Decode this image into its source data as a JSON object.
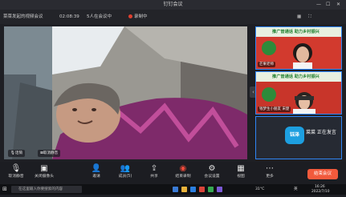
{
  "window": {
    "title": "钉钉会议"
  },
  "info": {
    "meeting_name": "菜菜发起的视频会议",
    "duration": "02:08:39",
    "participants": "5人在会议中",
    "recording": "录制中"
  },
  "main_video": {
    "mic_label": "话筒",
    "unmute_label": "取消静音"
  },
  "tiles": [
    {
      "name": "芒果老师",
      "banner": "推广普通话 助力乡村振兴"
    },
    {
      "name": "钱梦生小朋友",
      "sub": "宋楚",
      "banner": "推广普通话 助力乡村振兴"
    },
    {
      "name": "菜菜 正在发言",
      "logo_text": "钰泽"
    }
  ],
  "toolbar": {
    "items": [
      {
        "label": "取消静音",
        "icon": "mic-icon"
      },
      {
        "label": "关闭摄像头",
        "icon": "camera-icon"
      },
      {
        "label": "邀请",
        "icon": "invite-icon"
      },
      {
        "label": "成员(5)",
        "icon": "members-icon"
      },
      {
        "label": "共享",
        "icon": "share-icon"
      },
      {
        "label": "结束录制",
        "icon": "record-icon"
      },
      {
        "label": "会议设置",
        "icon": "settings-icon"
      },
      {
        "label": "视图",
        "icon": "view-icon"
      },
      {
        "label": "更多",
        "icon": "more-icon"
      }
    ],
    "end_label": "结束会议"
  },
  "taskbar": {
    "search_placeholder": "在这里输入你要搜索的内容",
    "weather": "31°C",
    "lang": "英",
    "time": "16:26",
    "date": "2022/7/10"
  }
}
